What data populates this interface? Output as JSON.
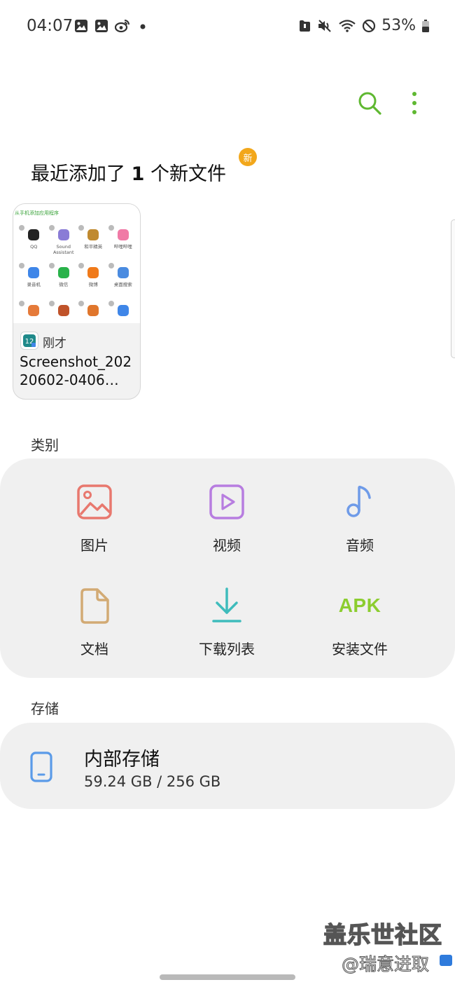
{
  "status_bar": {
    "time": "04:07",
    "battery": "53%",
    "left_icons": [
      "gallery-notification-icon",
      "gallery-notification-icon",
      "weibo-notification-icon",
      "dot-indicator"
    ],
    "right_icons": [
      "sd-card-icon",
      "mute-icon",
      "wifi-icon",
      "do-not-disturb-icon",
      "battery-icon"
    ]
  },
  "toolbar": {
    "search_icon": "search-icon",
    "menu_icon": "more-vertical-icon",
    "accent": "#5fb831"
  },
  "recent": {
    "title_prefix": "最近添加了",
    "count": "1",
    "title_suffix": "个新文件",
    "badge": "新",
    "file": {
      "time": "刚才",
      "name": "Screenshot_20220602-0406…",
      "thumb_title": "从手机添加应用程序",
      "thumb_apps": [
        {
          "label": "QQ",
          "color": "#222"
        },
        {
          "label": "Sound Assistant",
          "color": "#8a7cd6"
        },
        {
          "label": "和平精英",
          "color": "#c08a30"
        },
        {
          "label": "哔哩哔哩",
          "color": "#f07aa6"
        },
        {
          "label": "录音机",
          "color": "#3f86e8"
        },
        {
          "label": "微信",
          "color": "#29b24a"
        },
        {
          "label": "微博",
          "color": "#f07a1a"
        },
        {
          "label": "桌面搜索",
          "color": "#4a8be0"
        },
        {
          "label": "",
          "color": "#e57a3a"
        },
        {
          "label": "",
          "color": "#c0532a"
        },
        {
          "label": "",
          "color": "#e0762c"
        },
        {
          "label": "",
          "color": "#3f86e8"
        }
      ]
    }
  },
  "categories": {
    "title": "类别",
    "items": [
      {
        "label": "图片",
        "icon": "image-icon",
        "color": "#e8786e"
      },
      {
        "label": "视频",
        "icon": "video-icon",
        "color": "#b77de0"
      },
      {
        "label": "音频",
        "icon": "music-note-icon",
        "color": "#6f9be8"
      },
      {
        "label": "文档",
        "icon": "document-icon",
        "color": "#d2aa74"
      },
      {
        "label": "下载列表",
        "icon": "download-icon",
        "color": "#3fbcbc"
      },
      {
        "label": "安装文件",
        "icon": "apk-icon",
        "icon_text": "APK",
        "color": "#8ccd2f"
      }
    ]
  },
  "storage": {
    "title": "存储",
    "items": [
      {
        "name": "内部存储",
        "size": "59.24 GB / 256 GB",
        "icon": "phone-icon",
        "color": "#5b9be8"
      }
    ]
  },
  "watermark": {
    "line1": "盖乐世社区",
    "line2": "@瑞意进取"
  }
}
